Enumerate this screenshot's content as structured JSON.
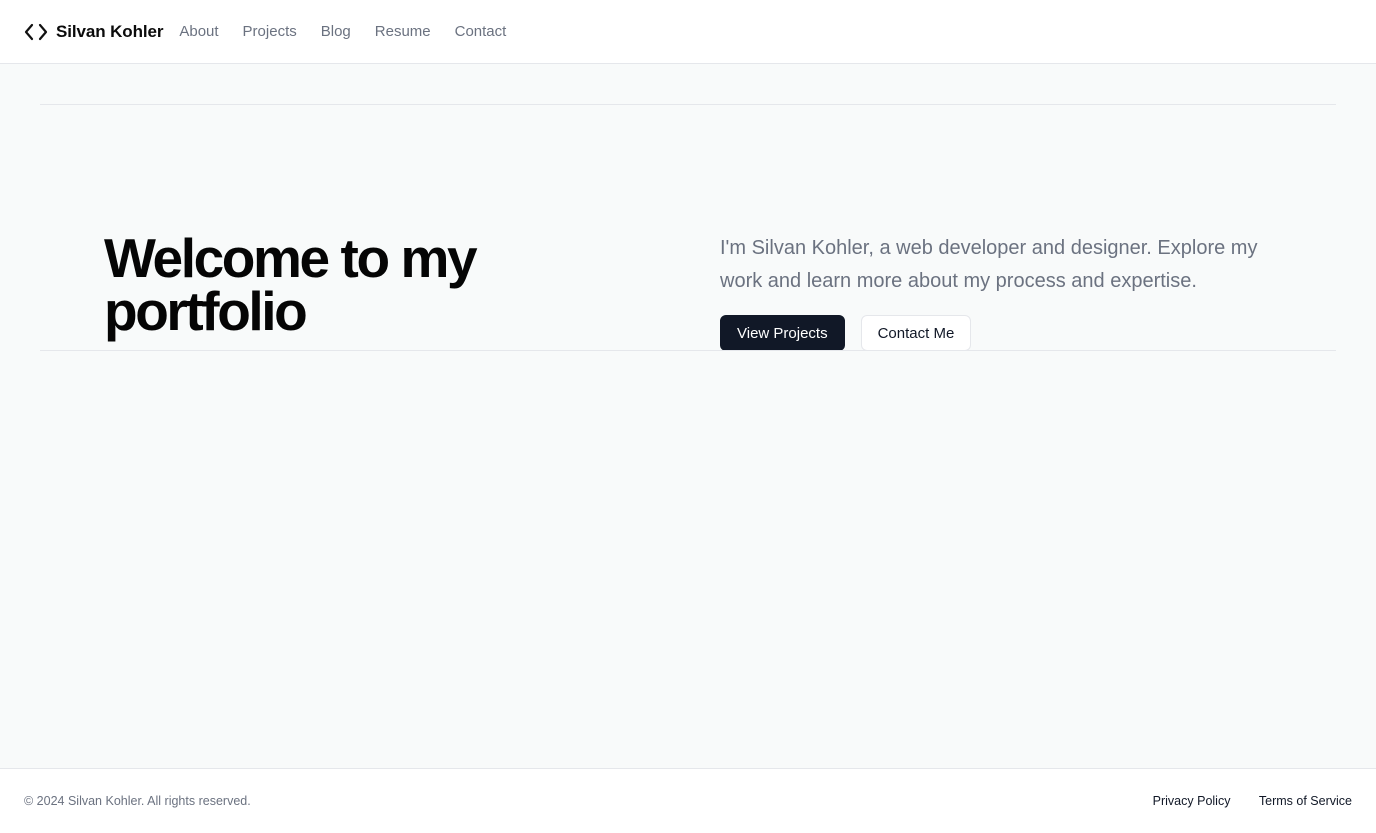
{
  "header": {
    "brand_icon": "code-brackets-icon",
    "brand_name": "Silvan Kohler",
    "nav": [
      {
        "label": "About"
      },
      {
        "label": "Projects"
      },
      {
        "label": "Blog"
      },
      {
        "label": "Resume"
      },
      {
        "label": "Contact"
      }
    ]
  },
  "hero": {
    "title": "Welcome to my portfolio",
    "description": "I'm Silvan Kohler, a web developer and designer. Explore my work and learn more about my process and expertise.",
    "primary_button": "View Projects",
    "secondary_button": "Contact Me"
  },
  "footer": {
    "copyright": "© 2024 Silvan Kohler. All rights reserved.",
    "links": [
      {
        "label": "Privacy Policy"
      },
      {
        "label": "Terms of Service"
      }
    ]
  },
  "colors": {
    "background": "#f8fafa",
    "primary_button": "#111827",
    "muted_text": "#6b7280"
  }
}
